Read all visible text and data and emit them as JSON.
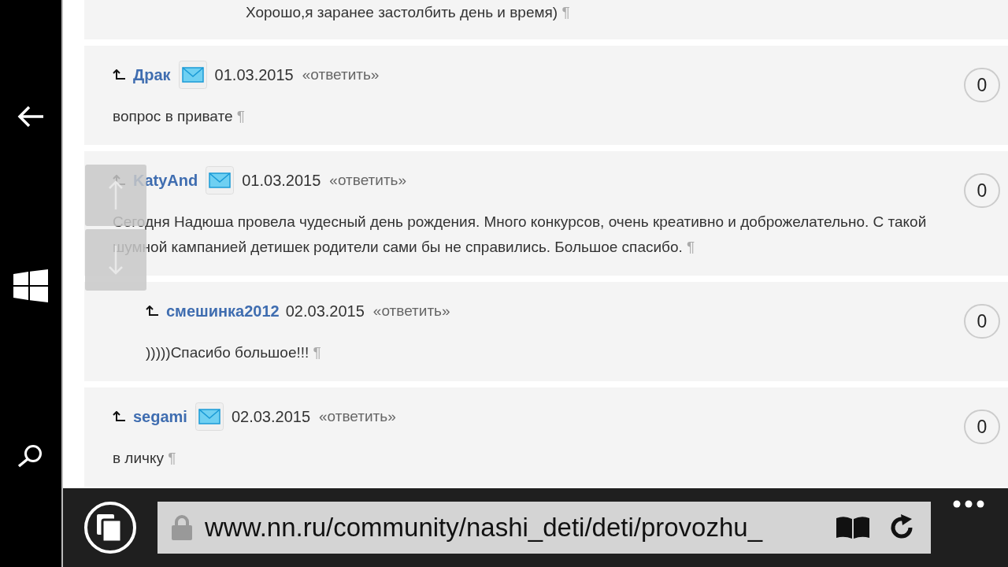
{
  "previous_comment": {
    "text": "Хорошо,я заранее застолбить день и время)",
    "mark": "¶"
  },
  "comments": [
    {
      "author": "Драк",
      "mail": true,
      "date": "01.03.2015",
      "reply_link": "«ответить»",
      "text": "вопрос в привате",
      "mark": "¶",
      "votes": "0"
    },
    {
      "author": "KatyAnd",
      "mail": true,
      "date": "01.03.2015",
      "reply_link": "«ответить»",
      "text": "Сегодня Надюша провела чудесный день рождения. Много конкурсов, очень креативно и доброжелательно. С такой шумной кампанией детишек родители сами бы не справились. Большое спасибо.",
      "mark": "¶",
      "votes": "0",
      "children": [
        {
          "author": "смешинка2012",
          "mail": false,
          "date": "02.03.2015",
          "reply_link": "«ответить»",
          "text": ")))))Спасибо большое!!!",
          "mark": "¶",
          "votes": "0"
        }
      ]
    },
    {
      "author": "segami",
      "mail": true,
      "date": "02.03.2015",
      "reply_link": "«ответить»",
      "text": "в личку",
      "mark": "¶",
      "votes": "0"
    }
  ],
  "address_bar": {
    "url": "www.nn.ru/community/nashi_deti/deti/provozhu_"
  }
}
